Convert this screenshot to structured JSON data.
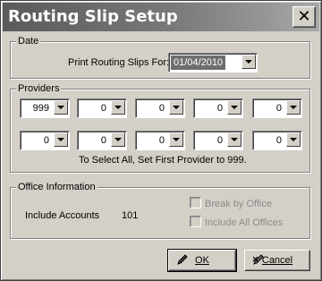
{
  "window": {
    "title": "Routing Slip Setup",
    "close_glyph": "✕"
  },
  "date": {
    "group_label": "Date",
    "print_label": "Print Routing Slips For:",
    "selected_date": "01/04/2010"
  },
  "providers": {
    "group_label": "Providers",
    "row1": [
      "999",
      "0",
      "0",
      "0",
      "0"
    ],
    "row2": [
      "0",
      "0",
      "0",
      "0",
      "0"
    ],
    "hint": "To Select All, Set First Provider to 999."
  },
  "office": {
    "group_label": "Office Information",
    "include_accounts_label": "Include Accounts",
    "include_accounts_value": "101",
    "break_by_office_label": "Break by Office",
    "include_all_offices_label": "Include All Offices"
  },
  "buttons": {
    "ok_label": "OK",
    "cancel_label": "Cancel",
    "ok_icon": "pencil-icon",
    "cancel_icon": "cancel-pencil-icon"
  },
  "colors": {
    "face": "#d4d0c8",
    "title_start": "#5a5a5a",
    "title_end": "#a8a8a8",
    "selection": "#6e6e6e",
    "disabled_text": "#8c8c8c"
  }
}
